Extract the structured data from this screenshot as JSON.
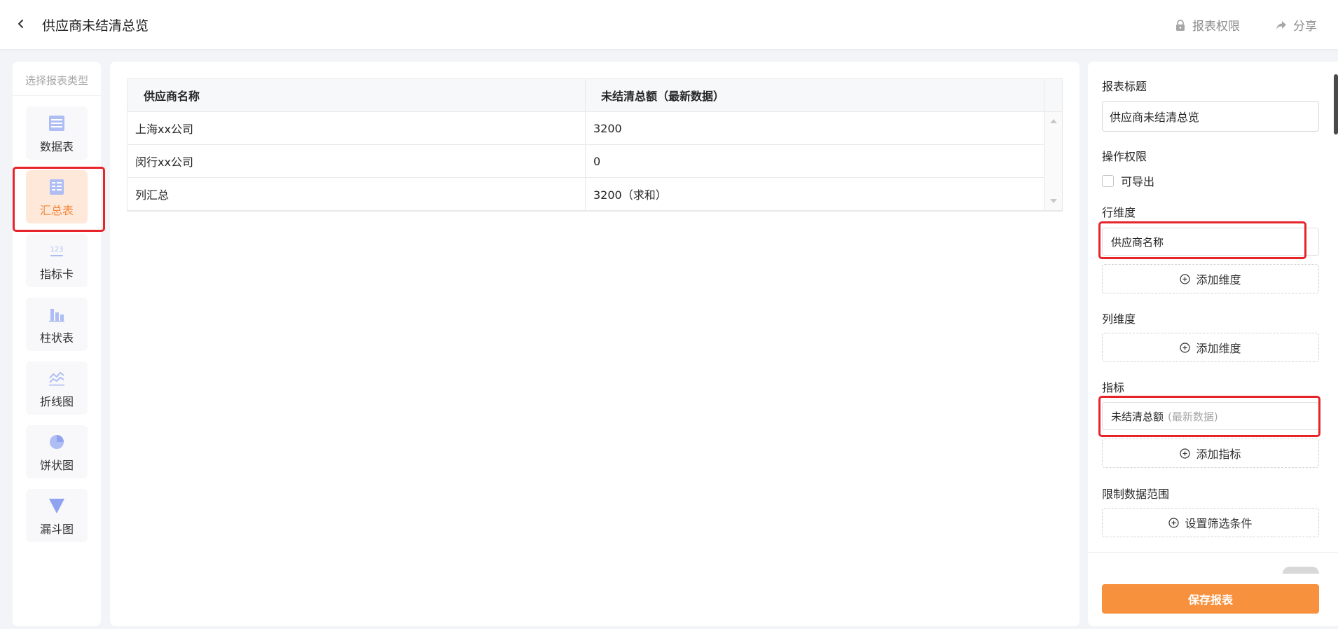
{
  "header": {
    "title": "供应商未结清总览",
    "actions": {
      "permission": "报表权限",
      "share": "分享"
    },
    "icons": {
      "back": "chevron-left-icon",
      "permission": "lock-icon",
      "share": "share-icon"
    }
  },
  "sidebar": {
    "title": "选择报表类型",
    "items": [
      {
        "label": "数据表",
        "icon": "table-icon",
        "active": false
      },
      {
        "label": "汇总表",
        "icon": "pivot-table-icon",
        "active": true
      },
      {
        "label": "指标卡",
        "icon": "metric-card-icon",
        "active": false
      },
      {
        "label": "柱状表",
        "icon": "bar-chart-icon",
        "active": false
      },
      {
        "label": "折线图",
        "icon": "line-chart-icon",
        "active": false
      },
      {
        "label": "饼状图",
        "icon": "pie-chart-icon",
        "active": false
      },
      {
        "label": "漏斗图",
        "icon": "funnel-chart-icon",
        "active": false
      }
    ]
  },
  "table": {
    "columns": [
      "供应商名称",
      "未结清总额（最新数据）"
    ],
    "rows": [
      [
        "上海xx公司",
        "3200"
      ],
      [
        "闵行xx公司",
        "0"
      ],
      [
        "列汇总",
        "3200（求和）"
      ]
    ]
  },
  "config": {
    "report_title_label": "报表标题",
    "report_title_value": "供应商未结清总览",
    "permission_label": "操作权限",
    "exportable_label": "可导出",
    "exportable_checked": false,
    "row_dimension_label": "行维度",
    "row_dimension_value": "供应商名称",
    "add_dimension": "添加维度",
    "column_dimension_label": "列维度",
    "metric_label": "指标",
    "metric_value": "未结清总额",
    "metric_sub": "(最新数据)",
    "add_metric": "添加指标",
    "filter_label": "限制数据范围",
    "filter_button": "设置筛选条件",
    "save_button": "保存报表"
  },
  "colors": {
    "accent": "#f7913d",
    "active_bg": "#fde8da",
    "highlight": "#e8242b"
  }
}
